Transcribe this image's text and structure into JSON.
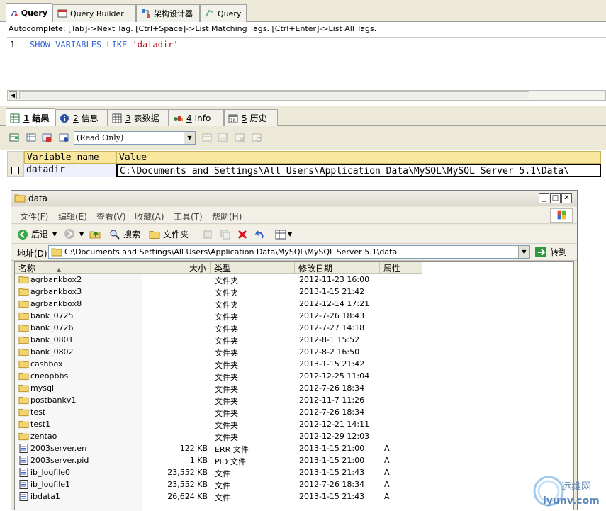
{
  "top_tabs": [
    "Query",
    "Query Builder",
    "架构设计器",
    "Query"
  ],
  "editor": {
    "autocomplete": "Autocomplete: [Tab]->Next Tag. [Ctrl+Space]->List Matching Tags. [Ctrl+Enter]->List All Tags.",
    "line_number": "1",
    "keywords": "SHOW VARIABLES LIKE",
    "string": "'datadir'"
  },
  "result_tabs": [
    {
      "num": "1",
      "label": "结果"
    },
    {
      "num": "2",
      "label": "信息"
    },
    {
      "num": "3",
      "label": "表数据"
    },
    {
      "num": "4",
      "label": "Info"
    },
    {
      "num": "5",
      "label": "历史"
    }
  ],
  "toolbar": {
    "mode": "(Read Only)"
  },
  "grid": {
    "headers": [
      "Variable_name",
      "Value"
    ],
    "row": [
      "datadir",
      "C:\\Documents and Settings\\All Users\\Application Data\\MySQL\\MySQL Server 5.1\\Data\\"
    ]
  },
  "explorer": {
    "title": "data",
    "menu": [
      "文件(F)",
      "编辑(E)",
      "查看(V)",
      "收藏(A)",
      "工具(T)",
      "帮助(H)"
    ],
    "tools": {
      "back": "后退",
      "search": "搜索",
      "folders": "文件夹"
    },
    "address_label": "地址(D)",
    "address": "C:\\Documents and Settings\\All Users\\Application Data\\MySQL\\MySQL Server 5.1\\data",
    "go": "转到",
    "columns": [
      "名称",
      "大小",
      "类型",
      "修改日期",
      "属性"
    ],
    "files": [
      {
        "name": "agrbankbox2",
        "size": "",
        "type": "文件夹",
        "date": "2012-11-23 16:00",
        "attr": "",
        "kind": "folder"
      },
      {
        "name": "agrbankbox3",
        "size": "",
        "type": "文件夹",
        "date": "2013-1-15 21:42",
        "attr": "",
        "kind": "folder"
      },
      {
        "name": "agrbankbox8",
        "size": "",
        "type": "文件夹",
        "date": "2012-12-14 17:21",
        "attr": "",
        "kind": "folder"
      },
      {
        "name": "bank_0725",
        "size": "",
        "type": "文件夹",
        "date": "2012-7-26 18:43",
        "attr": "",
        "kind": "folder"
      },
      {
        "name": "bank_0726",
        "size": "",
        "type": "文件夹",
        "date": "2012-7-27 14:18",
        "attr": "",
        "kind": "folder"
      },
      {
        "name": "bank_0801",
        "size": "",
        "type": "文件夹",
        "date": "2012-8-1 15:52",
        "attr": "",
        "kind": "folder"
      },
      {
        "name": "bank_0802",
        "size": "",
        "type": "文件夹",
        "date": "2012-8-2 16:50",
        "attr": "",
        "kind": "folder"
      },
      {
        "name": "cashbox",
        "size": "",
        "type": "文件夹",
        "date": "2013-1-15 21:42",
        "attr": "",
        "kind": "folder"
      },
      {
        "name": "cneopbbs",
        "size": "",
        "type": "文件夹",
        "date": "2012-12-25 11:04",
        "attr": "",
        "kind": "folder"
      },
      {
        "name": "mysql",
        "size": "",
        "type": "文件夹",
        "date": "2012-7-26 18:34",
        "attr": "",
        "kind": "folder"
      },
      {
        "name": "postbankv1",
        "size": "",
        "type": "文件夹",
        "date": "2012-11-7 11:26",
        "attr": "",
        "kind": "folder"
      },
      {
        "name": "test",
        "size": "",
        "type": "文件夹",
        "date": "2012-7-26 18:34",
        "attr": "",
        "kind": "folder"
      },
      {
        "name": "test1",
        "size": "",
        "type": "文件夹",
        "date": "2012-12-21 14:11",
        "attr": "",
        "kind": "folder"
      },
      {
        "name": "zentao",
        "size": "",
        "type": "文件夹",
        "date": "2012-12-29 12:03",
        "attr": "",
        "kind": "folder"
      },
      {
        "name": "2003server.err",
        "size": "122 KB",
        "type": "ERR 文件",
        "date": "2013-1-15 21:00",
        "attr": "A",
        "kind": "file"
      },
      {
        "name": "2003server.pid",
        "size": "1 KB",
        "type": "PID 文件",
        "date": "2013-1-15 21:00",
        "attr": "A",
        "kind": "file"
      },
      {
        "name": "ib_logfile0",
        "size": "23,552 KB",
        "type": "文件",
        "date": "2013-1-15 21:43",
        "attr": "A",
        "kind": "file"
      },
      {
        "name": "ib_logfile1",
        "size": "23,552 KB",
        "type": "文件",
        "date": "2012-7-26 18:34",
        "attr": "A",
        "kind": "file"
      },
      {
        "name": "ibdata1",
        "size": "26,624 KB",
        "type": "文件",
        "date": "2013-1-15 21:43",
        "attr": "A",
        "kind": "file"
      }
    ]
  },
  "watermark": {
    "cn": "运维网",
    "url": "iyunv.com"
  }
}
